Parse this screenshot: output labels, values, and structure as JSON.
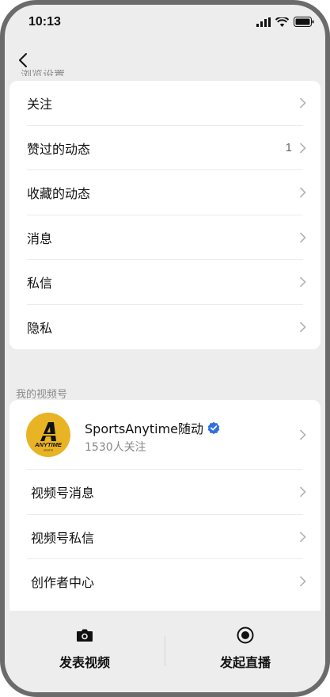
{
  "status_bar": {
    "time": "10:13"
  },
  "partial_header": "浏览设置",
  "settings_list": [
    {
      "label": "关注",
      "count": ""
    },
    {
      "label": "赞过的动态",
      "count": "1"
    },
    {
      "label": "收藏的动态",
      "count": ""
    },
    {
      "label": "消息",
      "count": ""
    },
    {
      "label": "私信",
      "count": ""
    },
    {
      "label": "隐私",
      "count": ""
    }
  ],
  "channel_section": {
    "title": "我的视频号",
    "account": {
      "name": "SportsAnytime随动",
      "followers": "1530人关注",
      "logo_text": "ANYTIME",
      "logo_small": "SPORTS"
    },
    "items": [
      {
        "label": "视频号消息"
      },
      {
        "label": "视频号私信"
      },
      {
        "label": "创作者中心"
      }
    ]
  },
  "bottom_bar": {
    "publish_video": "发表视频",
    "start_live": "发起直播"
  },
  "colors": {
    "background": "#ededed",
    "logo_bg": "#e8b325",
    "verified": "#2f6fe0"
  }
}
